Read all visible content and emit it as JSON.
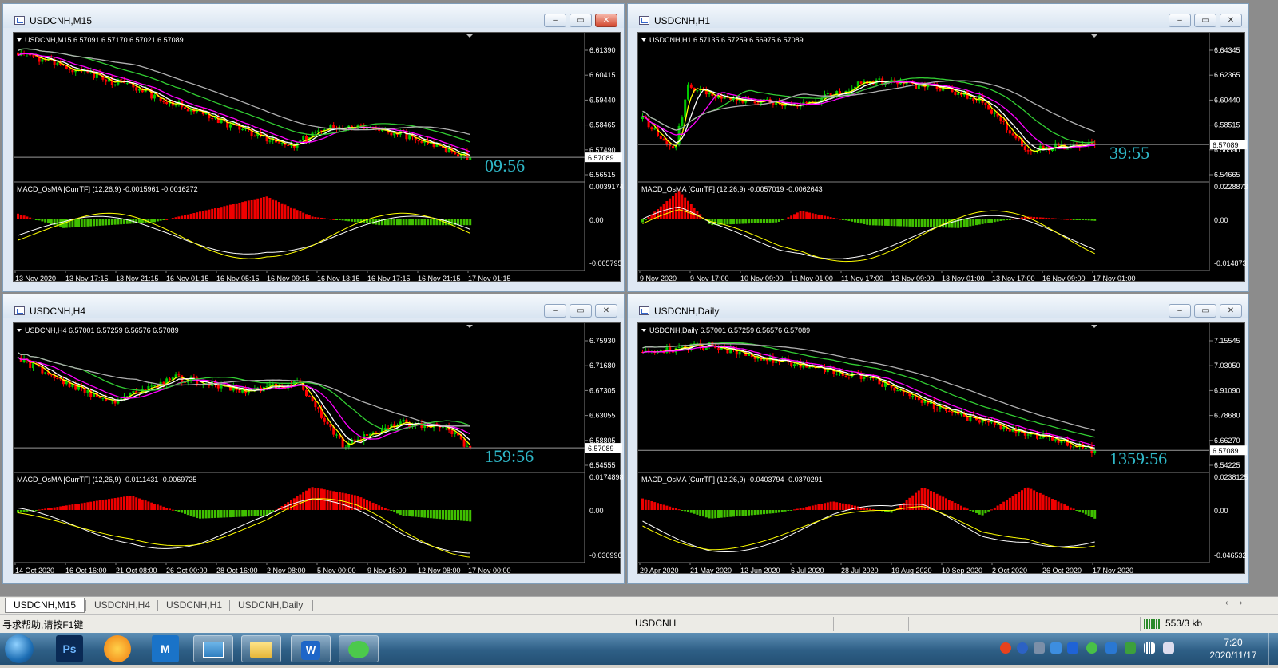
{
  "windows": [
    {
      "key": "m15",
      "title": "USDCNH,M15",
      "ohlc_line": "USDCNH,M15  6.57091 6.57170 6.57021 6.57089",
      "osma_label": "MACD_OsMA [CurrTF] (12,26,9) -0.0015961 -0.0016272",
      "price_ticks": [
        "6.61390",
        "6.60415",
        "6.59440",
        "6.58465",
        "6.57490",
        "6.56515"
      ],
      "current_price": "6.57089",
      "osma_ticks": [
        "0.0039174",
        "0.00",
        "-0.005795"
      ],
      "countdown": "09:56",
      "time_ticks": [
        "13 Nov 2020",
        "13 Nov 17:15",
        "13 Nov 21:15",
        "16 Nov 01:15",
        "16 Nov 05:15",
        "16 Nov 09:15",
        "16 Nov 13:15",
        "16 Nov 17:15",
        "16 Nov 21:15",
        "17 Nov 01:15"
      ]
    },
    {
      "key": "h1",
      "title": "USDCNH,H1",
      "ohlc_line": "USDCNH,H1  6.57135 6.57259 6.56975 6.57089",
      "osma_label": "MACD_OsMA [CurrTF] (12,26,9) -0.0057019 -0.0062643",
      "price_ticks": [
        "6.64345",
        "6.62365",
        "6.60440",
        "6.58515",
        "6.56590",
        "6.54665"
      ],
      "current_price": "6.57089",
      "osma_ticks": [
        "0.0228873",
        "0.00",
        "-0.014873"
      ],
      "countdown": "39:55",
      "time_ticks": [
        "9 Nov 2020",
        "9 Nov 17:00",
        "10 Nov 09:00",
        "11 Nov 01:00",
        "11 Nov 17:00",
        "12 Nov 09:00",
        "13 Nov 01:00",
        "13 Nov 17:00",
        "16 Nov 09:00",
        "17 Nov 01:00"
      ]
    },
    {
      "key": "h4",
      "title": "USDCNH,H4",
      "ohlc_line": "USDCNH,H4  6.57001 6.57259 6.56576 6.57089",
      "osma_label": "MACD_OsMA [CurrTF] (12,26,9) -0.0111431 -0.0069725",
      "price_ticks": [
        "6.75930",
        "6.71680",
        "6.67305",
        "6.63055",
        "6.58805",
        "6.54555"
      ],
      "current_price": "6.57089",
      "osma_ticks": [
        "0.0174898",
        "0.00",
        "-0.030996"
      ],
      "countdown": "159:56",
      "time_ticks": [
        "14 Oct 2020",
        "16 Oct 16:00",
        "21 Oct 08:00",
        "26 Oct 00:00",
        "28 Oct 16:00",
        "2 Nov 08:00",
        "5 Nov 00:00",
        "9 Nov 16:00",
        "12 Nov 08:00",
        "17 Nov 00:00"
      ]
    },
    {
      "key": "d1",
      "title": "USDCNH,Daily",
      "ohlc_line": "USDCNH,Daily  6.57001 6.57259 6.56576 6.57089",
      "osma_label": "MACD_OsMA [CurrTF] (12,26,9) -0.0403794 -0.0370291",
      "price_ticks": [
        "7.15545",
        "7.03050",
        "6.91090",
        "6.78680",
        "6.66270",
        "6.54225"
      ],
      "current_price": "6.57089",
      "osma_ticks": [
        "0.0238125",
        "0.00",
        "-0.046532"
      ],
      "countdown": "1359:56",
      "time_ticks": [
        "29 Apr 2020",
        "21 May 2020",
        "12 Jun 2020",
        "6 Jul 2020",
        "28 Jul 2020",
        "19 Aug 2020",
        "10 Sep 2020",
        "2 Oct 2020",
        "26 Oct 2020",
        "17 Nov 2020"
      ]
    }
  ],
  "tabs": [
    "USDCNH,M15",
    "USDCNH,H4",
    "USDCNH,H1",
    "USDCNH,Daily"
  ],
  "statusbar": {
    "help": "寻求帮助,请按F1键",
    "profile": "USDCNH",
    "traffic": "553/3 kb"
  },
  "taskbar": {
    "time": "7:20",
    "date": "2020/11/17"
  },
  "colors": {
    "bull": "#00c800",
    "bear": "#ff0000",
    "osma_up": "#f00000",
    "osma_down": "#40c000",
    "ma_yellow": "#ffff00",
    "ma_white": "#ffffff",
    "ma_magenta": "#ff00ff",
    "ma_green": "#32cd32",
    "ma_gray": "#b0b0b0",
    "countdown": "#2fb8c8"
  }
}
